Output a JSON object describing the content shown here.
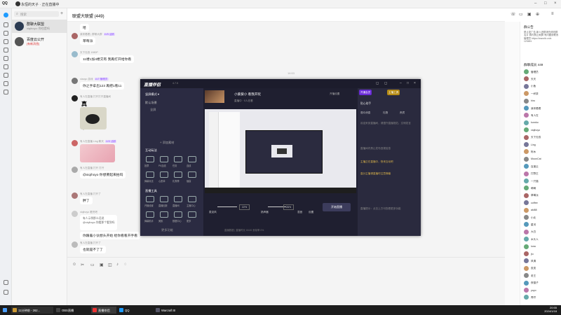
{
  "window": {
    "app_name": "QQ",
    "title": "永恒的天子 · 正在直播中"
  },
  "search": {
    "placeholder": "搜索"
  },
  "chats": [
    {
      "name": "群聊大联盟",
      "preview": "xiqihoyo: 你也是吗",
      "selected": true
    },
    {
      "name": "百度云公开",
      "preview": "[有新消息] 大家好",
      "unread_tag": "[有新消息]"
    }
  ],
  "chat": {
    "title": "联盟大联盟 (449)"
  },
  "messages": [
    {
      "name": "",
      "text": "哈"
    },
    {
      "name": "我来看看 | 群聊大群",
      "badge": "LV5 活跃",
      "text": "草莓派"
    },
    {
      "name": "天下无双 1080P",
      "text": "11楼1加4楼交有 我再打开给你看"
    },
    {
      "name": "xiaoyu 游戏",
      "badge": "LV7 管理员",
      "text": "你之手拿出123 再把1看11"
    },
    {
      "name": "有人在直播 打开打开直播间",
      "big": "真没拍了"
    },
    {
      "name": "有人在直播 Ling 聊天",
      "badge": "LV3 活跃"
    },
    {
      "name": "有人在直播 打开 打开",
      "text": "@xiqihoyo 你想要起来拍吗"
    },
    {
      "name": "有人在直播 打开了",
      "text": "胖了"
    },
    {
      "name": "xiqihoyo 看完吧",
      "quote": [
        "有人示例那么话说",
        "@xiqihoyo 你看那个看到吗"
      ],
      "text": "你跟着小伙想头开始 给你看看开手看"
    },
    {
      "name": "有人在直播 打开了",
      "text": "也就是不了了"
    }
  ],
  "system_time": "16:53",
  "right_panel": {
    "announce_title": "群公告",
    "announce_text": "禁止发广告 新人进群请先修改群名片 群内禁止刷屏 有问题请联系管理员 https://www.tb.cn/s 123481",
    "members_title": "群聊成员 449",
    "members": [
      "管理员",
      "天天",
      "小鱼",
      "一杯茶",
      "hiro",
      "我来看看",
      "有人在",
      "kuroko",
      "xiqihoyo",
      "天下无双",
      "Ling",
      "阿木",
      "MoonCat",
      "百度云",
      "打野王",
      "一只猫",
      "萌萌",
      "草莓派",
      "coffee",
      "aki88",
      "小北",
      "星河",
      "大白",
      "木头人",
      "luna",
      "jiu",
      "风清",
      "皮皮",
      "老王",
      "夜猫子",
      "yoyo",
      "青柠"
    ]
  },
  "live": {
    "brand": "直播伴侣",
    "version": "4.7.5",
    "scene_mode": "竖屏模式",
    "scene_name": "默认场景",
    "scene_item": "全屏",
    "add_material": "+ 添加素材",
    "interact_title": "互动玩法",
    "interact_tools": [
      "投票",
      "PK连线",
      "任务",
      "连线",
      "弹幕玩法",
      "心愿单",
      "礼物榜",
      "福袋"
    ],
    "tools_title": "直播工具",
    "live_tools": [
      "开播设置",
      "直播回放",
      "直播间",
      "主播中心",
      "弹幕助手",
      "美颜",
      "数据中心",
      "更多"
    ],
    "more_features": "更多功能",
    "room_title": "小葵葵小 看我开玩",
    "room_info": "直播中 · 0人在看",
    "top_right_chips": [
      "开通会员",
      "主播工具",
      "开播设置"
    ],
    "audience_tabs": [
      "观众消息",
      "礼物",
      "贵宾"
    ],
    "audience_header": "贴心助手",
    "notice_lines": [
      "欢迎来到直播间，请遵守直播规范，文明发言",
      "直播间内禁止发布违规信息",
      "主播正在直播中，快来互动吧",
      "高分主播请直播时注意弹幕",
      "直播提示：点击上方可查看更多功能"
    ],
    "mic_label": "麦克风",
    "speaker_label": "扬声器",
    "mic_level": "22%",
    "speaker_level": "26%",
    "bottom_btns": [
      "混音",
      "设置"
    ],
    "start_live": "开始直播",
    "footer": "直播数据 | 直播时长 00:00  丢帧率 0%"
  },
  "taskbar": {
    "items": [
      "11分钟前 - 262...",
      "OBS直播",
      "直播伴侣",
      "QQ",
      "Warcraft III"
    ],
    "time": "20:55",
    "date": "2024/1/18"
  }
}
